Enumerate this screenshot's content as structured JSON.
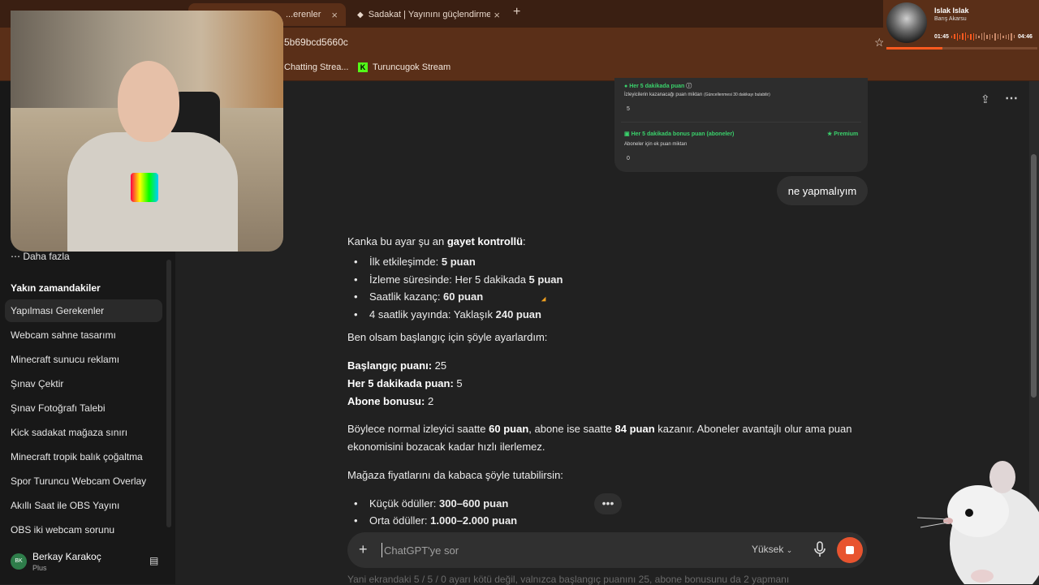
{
  "browser": {
    "tabs": [
      {
        "label": "...erenler",
        "active": true
      },
      {
        "label": "Sadakat | Yayınını güçlendirmek",
        "active": false
      }
    ],
    "new_tab_symbol": "+",
    "close_symbol": "×",
    "url": "5b69bcd5660c",
    "bookmarks": [
      "Chatting Strea...",
      "Turuncugok Stream"
    ]
  },
  "music_widget": {
    "title": "Islak Islak",
    "artist": "Barış Akarsu",
    "current_time": "01:45",
    "total_time": "04:46",
    "progress": 0.37
  },
  "sidebar": {
    "more_label": "Daha fazla",
    "recent_heading": "Yakın zamandakiler",
    "items": [
      {
        "label": "Yapılması Gerekenler",
        "active": true
      },
      {
        "label": "Webcam sahne tasarımı"
      },
      {
        "label": "Minecraft sunucu reklamı"
      },
      {
        "label": "Şınav Çektir"
      },
      {
        "label": "Şınav Fotoğrafı Talebi"
      },
      {
        "label": "Kick sadakat mağaza sınırı"
      },
      {
        "label": "Minecraft tropik balık çoğaltma"
      },
      {
        "label": "Spor Turuncu Webcam Overlay"
      },
      {
        "label": "Akıllı Saat ile OBS Yayını"
      },
      {
        "label": "OBS iki webcam sorunu"
      }
    ],
    "user": {
      "initials": "BK",
      "name": "Berkay Karakoç",
      "plan": "Plus"
    }
  },
  "embed": {
    "row1_title": "Her 5 dakikada puan",
    "row1_desc": "İzleyicilerin kazanacağı puan miktarı",
    "row1_note": "(Güncellenmesi 30 dakikayı bulabilir)",
    "row1_value": "5",
    "row2_title": "Her 5 dakikada bonus puan (aboneler)",
    "row2_badge": "Premium",
    "row2_desc": "Aboneler için ek puan miktarı",
    "row2_value": "0"
  },
  "user_message": "ne yapmalıyım",
  "assistant": {
    "intro_plain": "Kanka bu ayar şu an ",
    "intro_bold": "gayet kontrollü",
    "intro_end": ":",
    "bullets": [
      {
        "plain": "İlk etkileşimde: ",
        "bold": "5 puan",
        "tail": ""
      },
      {
        "plain": "İzleme süresinde: Her 5 dakikada ",
        "bold": "5 puan",
        "tail": ""
      },
      {
        "plain": "Saatlik kazanç: ",
        "bold": "60 puan",
        "tail": ""
      },
      {
        "plain": "4 saatlik yayında: Yaklaşık ",
        "bold": "240 puan",
        "tail": ""
      }
    ],
    "setup_intro": "Ben olsam başlangıç için şöyle ayarlardım:",
    "settings": [
      {
        "label": "Başlangıç puanı:",
        "value": " 25"
      },
      {
        "label": "Her 5 dakikada puan:",
        "value": " 5"
      },
      {
        "label": "Abone bonusu:",
        "value": " 2"
      }
    ],
    "summary_p1": "Böylece normal izleyici saatte ",
    "summary_b1": "60 puan",
    "summary_p2": ", abone ise saatte ",
    "summary_b2": "84 puan",
    "summary_p3": " kazanır. Aboneler avantajlı olur ama puan",
    "summary_line2": "ekonomisini bozacak kadar hızlı ilerlemez.",
    "store_intro": "Mağaza fiyatlarını da kabaca şöyle tutabilirsin:",
    "store_bullets": [
      {
        "plain": "Küçük ödüller: ",
        "bold": "300–600 puan"
      },
      {
        "plain": "Orta ödüller: ",
        "bold": "1.000–2.000 puan"
      }
    ]
  },
  "composer": {
    "placeholder": "ChatGPT'ye sor",
    "model": "Yüksek"
  },
  "footer_partial": "Yani ekrandaki 5 / 5 / 0 ayarı kötü değil, valnızca başlangıç puanını 25, abone bonusunu da 2 yapmanı",
  "colors": {
    "accent_orange": "#e8542f",
    "kick_green": "#53fc18",
    "embed_green": "#3ad06b",
    "chrome_brown": "#5a2f18"
  }
}
